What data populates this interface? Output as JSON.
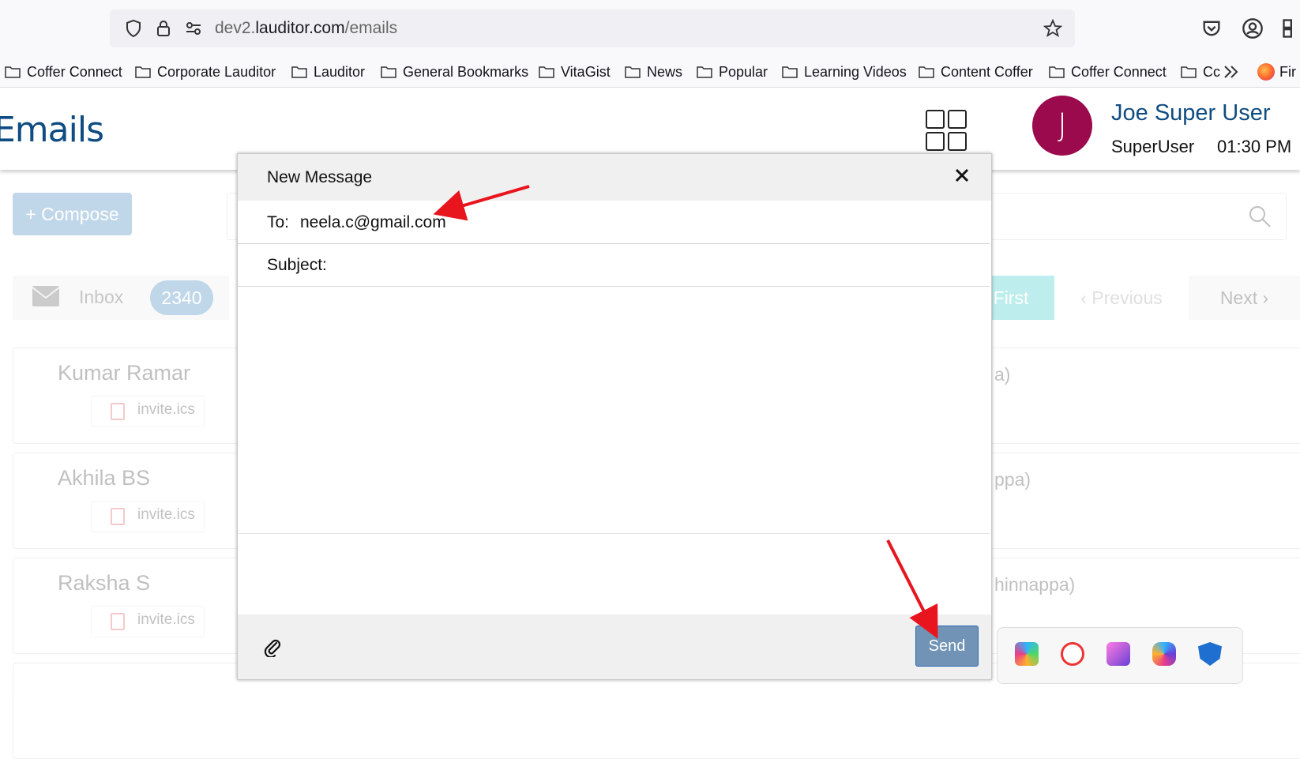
{
  "browser": {
    "url_prefix": "dev2.",
    "url_domain": "lauditor.com",
    "url_path": "/emails",
    "bookmarks": [
      "Coffer Connect",
      "Corporate Lauditor",
      "Lauditor",
      "General Bookmarks",
      "VitaGist",
      "News",
      "Popular",
      "Learning Videos",
      "Content Coffer",
      "Coffer Connect",
      "Cc"
    ],
    "overflow_label": "Fir"
  },
  "header": {
    "title": "Emails",
    "user_initial": "J",
    "user_name": "Joe Super User",
    "user_role": "SuperUser",
    "time": "01:30 PM"
  },
  "toolbar": {
    "compose_label": "+ Compose"
  },
  "inbox": {
    "label": "Inbox",
    "count": "2340"
  },
  "pagination": {
    "first": "First",
    "previous": "Previous",
    "next": "Next"
  },
  "emails": [
    {
      "sender": "Kumar Ramar",
      "attachment": "invite.ics",
      "right_text": "a)"
    },
    {
      "sender": "Akhila BS",
      "attachment": "invite.ics",
      "right_text": "ppa)"
    },
    {
      "sender": "Raksha S",
      "attachment": "invite.ics",
      "right_text": "hinnappa)"
    }
  ],
  "compose_modal": {
    "title": "New Message",
    "to_label": "To:",
    "to_value": "neela.c@gmail.com",
    "subject_label": "Subject:",
    "subject_value": "",
    "send_label": "Send"
  },
  "colors": {
    "brand_blue": "#0f4c81",
    "avatar": "#9b0a4c",
    "send_button": "#7193b5",
    "annotation_arrow": "#e8141e"
  }
}
